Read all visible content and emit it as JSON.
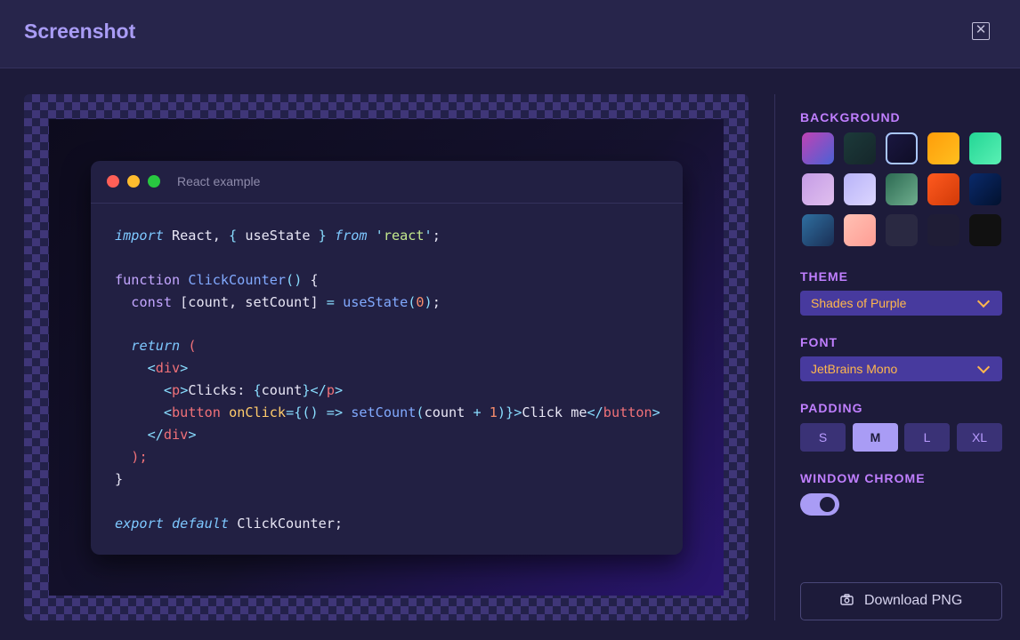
{
  "header": {
    "title": "Screenshot"
  },
  "preview": {
    "window_title": "React example",
    "code_lines": [
      [
        [
          "kw-i",
          "import"
        ],
        [
          "plain",
          " React, "
        ],
        [
          "op",
          "{"
        ],
        [
          "plain",
          " useState "
        ],
        [
          "op",
          "}"
        ],
        [
          "plain",
          " "
        ],
        [
          "kw-i",
          "from"
        ],
        [
          "plain",
          " "
        ],
        [
          "op",
          "'"
        ],
        [
          "str",
          "react"
        ],
        [
          "op",
          "'"
        ],
        [
          "plain",
          ";"
        ]
      ],
      [],
      [
        [
          "kw",
          "function"
        ],
        [
          "plain",
          " "
        ],
        [
          "fn",
          "ClickCounter"
        ],
        [
          "op",
          "()"
        ],
        [
          "plain",
          " {"
        ]
      ],
      [
        [
          "plain",
          "  "
        ],
        [
          "kw",
          "const"
        ],
        [
          "plain",
          " [count, setCount] "
        ],
        [
          "op",
          "="
        ],
        [
          "plain",
          " "
        ],
        [
          "fn",
          "useState"
        ],
        [
          "op",
          "("
        ],
        [
          "num",
          "0"
        ],
        [
          "op",
          ")"
        ],
        [
          "plain",
          ";"
        ]
      ],
      [],
      [
        [
          "plain",
          "  "
        ],
        [
          "kw-i",
          "return"
        ],
        [
          "plain",
          " "
        ],
        [
          "tag",
          "("
        ]
      ],
      [
        [
          "plain",
          "    "
        ],
        [
          "op",
          "<"
        ],
        [
          "tag",
          "div"
        ],
        [
          "op",
          ">"
        ]
      ],
      [
        [
          "plain",
          "      "
        ],
        [
          "op",
          "<"
        ],
        [
          "tag",
          "p"
        ],
        [
          "op",
          ">"
        ],
        [
          "plain",
          "Clicks: "
        ],
        [
          "op",
          "{"
        ],
        [
          "plain",
          "count"
        ],
        [
          "op",
          "}"
        ],
        [
          "op",
          "</"
        ],
        [
          "tag",
          "p"
        ],
        [
          "op",
          ">"
        ]
      ],
      [
        [
          "plain",
          "      "
        ],
        [
          "op",
          "<"
        ],
        [
          "tag",
          "button"
        ],
        [
          "plain",
          " "
        ],
        [
          "attr",
          "onClick"
        ],
        [
          "op",
          "={() =>"
        ],
        [
          "plain",
          " "
        ],
        [
          "fn",
          "setCount"
        ],
        [
          "op",
          "("
        ],
        [
          "plain",
          "count "
        ],
        [
          "op",
          "+"
        ],
        [
          "plain",
          " "
        ],
        [
          "num",
          "1"
        ],
        [
          "op",
          ")}>"
        ],
        [
          "plain",
          "Click me"
        ],
        [
          "op",
          "</"
        ],
        [
          "tag",
          "button"
        ],
        [
          "op",
          ">"
        ]
      ],
      [
        [
          "plain",
          "    "
        ],
        [
          "op",
          "</"
        ],
        [
          "tag",
          "div"
        ],
        [
          "op",
          ">"
        ]
      ],
      [
        [
          "plain",
          "  "
        ],
        [
          "tag",
          ");"
        ]
      ],
      [
        [
          "plain",
          "}"
        ]
      ],
      [],
      [
        [
          "kw-i",
          "export"
        ],
        [
          "plain",
          " "
        ],
        [
          "kw-i",
          "default"
        ],
        [
          "plain",
          " ClickCounter;"
        ]
      ]
    ]
  },
  "sidebar": {
    "background_label": "BACKGROUND",
    "backgrounds": [
      "linear-gradient(135deg,#c042b4,#4a62d6)",
      "linear-gradient(135deg,#1c3a3a,#15262a)",
      "linear-gradient(135deg,#1a1740,#0f0d26)",
      "linear-gradient(135deg,#ff9d0a,#ffbf1f)",
      "linear-gradient(135deg,#23d695,#5af0b4)",
      "linear-gradient(135deg,#c59ce6,#e0bfee)",
      "linear-gradient(135deg,#b8b3f8,#dcd6ff)",
      "linear-gradient(135deg,#2c6a52,#6fae8e)",
      "linear-gradient(135deg,#ff5a1f,#d13a08)",
      "linear-gradient(135deg,#0a2a6b,#02112e)",
      "linear-gradient(135deg,#2f6fa0,#1a2f55)",
      "linear-gradient(135deg,#ffc1b4,#ff9d94)",
      "#2a2942",
      "#1f1d36",
      "#111111"
    ],
    "selected_background": 2,
    "theme_label": "THEME",
    "theme_value": "Shades of Purple",
    "font_label": "FONT",
    "font_value": "JetBrains Mono",
    "padding_label": "PADDING",
    "padding_options": [
      "S",
      "M",
      "L",
      "XL"
    ],
    "padding_selected": 1,
    "chrome_label": "WINDOW CHROME",
    "chrome_enabled": true,
    "download_label": "Download PNG"
  }
}
